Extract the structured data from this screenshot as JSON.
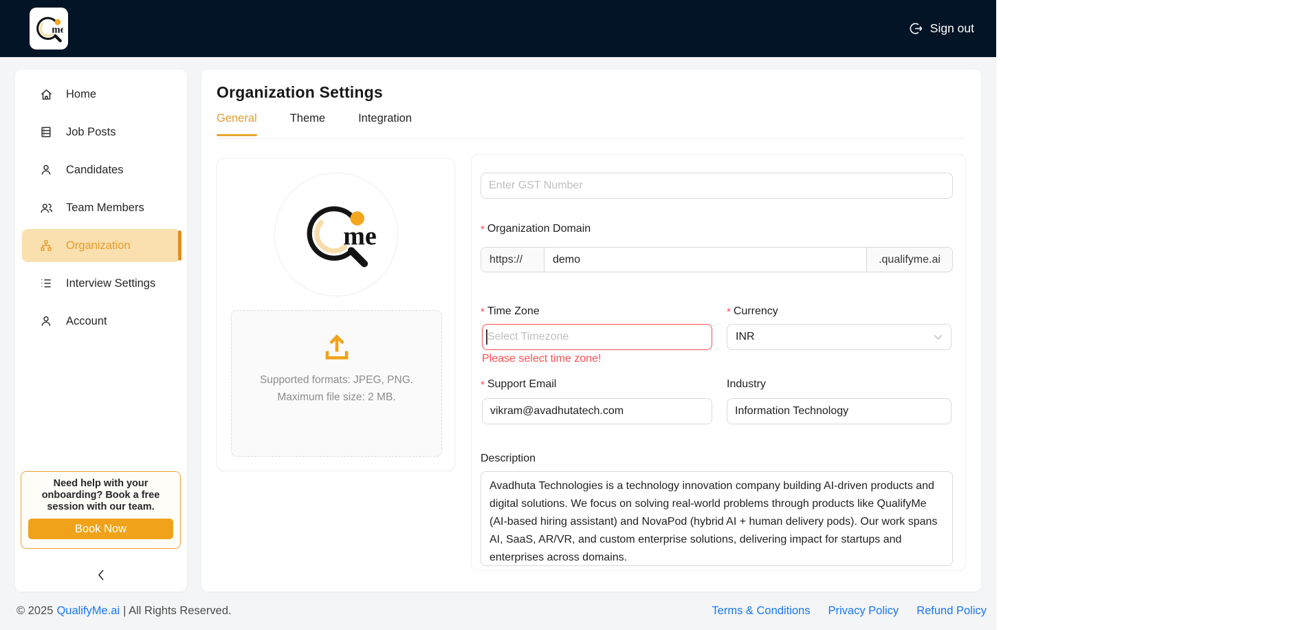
{
  "navbar": {
    "signout_label": "Sign out"
  },
  "logo": {
    "me_text": "me"
  },
  "sidebar": {
    "items": [
      {
        "label": "Home",
        "icon": "home-icon",
        "active": false
      },
      {
        "label": "Job Posts",
        "icon": "job-posts-icon",
        "active": false
      },
      {
        "label": "Candidates",
        "icon": "user-icon",
        "active": false
      },
      {
        "label": "Team Members",
        "icon": "team-icon",
        "active": false
      },
      {
        "label": "Organization",
        "icon": "org-chart-icon",
        "active": true
      },
      {
        "label": "Interview Settings",
        "icon": "list-icon",
        "active": false
      },
      {
        "label": "Account",
        "icon": "user-icon",
        "active": false
      }
    ],
    "help": {
      "line1": "Need help with your",
      "line2": "onboarding? Book a free",
      "line3": "session with our team.",
      "button_label": "Book Now"
    }
  },
  "main": {
    "title": "Organization Settings",
    "tabs": [
      {
        "label": "General",
        "active": true
      },
      {
        "label": "Theme",
        "active": false
      },
      {
        "label": "Integration",
        "active": false
      }
    ],
    "upload": {
      "line1": "Supported formats: JPEG, PNG.",
      "line2": "Maximum file size: 2 MB."
    },
    "form": {
      "required_marker": "*",
      "gst": {
        "placeholder": "Enter GST Number"
      },
      "domain": {
        "label": "Organization Domain",
        "prefix": "https://",
        "value": "demo",
        "suffix": ".qualifyme.ai"
      },
      "timezone": {
        "label": "Time Zone",
        "placeholder": "Select Timezone",
        "error": "Please select time zone!"
      },
      "currency": {
        "label": "Currency",
        "value": "INR"
      },
      "support_email": {
        "label": "Support Email",
        "value": "vikram@avadhutatech.com"
      },
      "industry": {
        "label": "Industry",
        "value": "Information Technology"
      },
      "description": {
        "label": "Description",
        "value": "Avadhuta Technologies is a technology innovation company building AI-driven products and digital solutions. We focus on solving real-world problems through products like QualifyMe (AI-based hiring assistant) and NovaPod (hybrid AI + human delivery pods). Our work spans AI, SaaS, AR/VR, and custom enterprise solutions, delivering impact for startups and enterprises across domains."
      }
    }
  },
  "footer": {
    "copyright_prefix": "© 2025",
    "brand_link": "QualifyMe.ai",
    "copyright_suffix": "| All Rights Reserved.",
    "links": [
      "Terms & Conditions",
      "Privacy Policy",
      "Refund Policy"
    ]
  },
  "colors": {
    "navbar_bg": "#031426",
    "accent_orange": "#F0A31A",
    "active_item_bg": "#FBE0AF",
    "active_item_text": "#E89B2D",
    "error_red": "#FF4D4F",
    "link_blue": "#1677FF",
    "page_bg": "#F4F5F6"
  }
}
